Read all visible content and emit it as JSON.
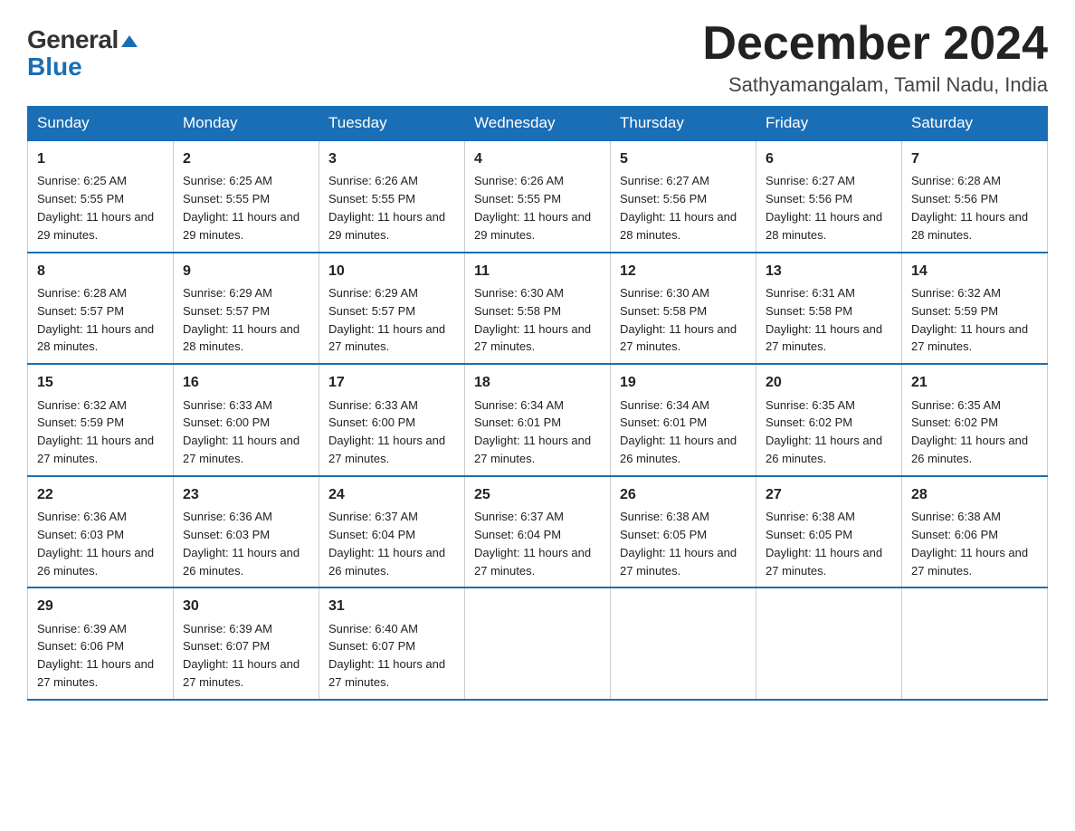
{
  "header": {
    "logo_general": "General",
    "logo_blue": "Blue",
    "month_title": "December 2024",
    "location": "Sathyamangalam, Tamil Nadu, India"
  },
  "weekdays": [
    "Sunday",
    "Monday",
    "Tuesday",
    "Wednesday",
    "Thursday",
    "Friday",
    "Saturday"
  ],
  "weeks": [
    [
      {
        "day": "1",
        "sunrise": "6:25 AM",
        "sunset": "5:55 PM",
        "daylight": "11 hours and 29 minutes."
      },
      {
        "day": "2",
        "sunrise": "6:25 AM",
        "sunset": "5:55 PM",
        "daylight": "11 hours and 29 minutes."
      },
      {
        "day": "3",
        "sunrise": "6:26 AM",
        "sunset": "5:55 PM",
        "daylight": "11 hours and 29 minutes."
      },
      {
        "day": "4",
        "sunrise": "6:26 AM",
        "sunset": "5:55 PM",
        "daylight": "11 hours and 29 minutes."
      },
      {
        "day": "5",
        "sunrise": "6:27 AM",
        "sunset": "5:56 PM",
        "daylight": "11 hours and 28 minutes."
      },
      {
        "day": "6",
        "sunrise": "6:27 AM",
        "sunset": "5:56 PM",
        "daylight": "11 hours and 28 minutes."
      },
      {
        "day": "7",
        "sunrise": "6:28 AM",
        "sunset": "5:56 PM",
        "daylight": "11 hours and 28 minutes."
      }
    ],
    [
      {
        "day": "8",
        "sunrise": "6:28 AM",
        "sunset": "5:57 PM",
        "daylight": "11 hours and 28 minutes."
      },
      {
        "day": "9",
        "sunrise": "6:29 AM",
        "sunset": "5:57 PM",
        "daylight": "11 hours and 28 minutes."
      },
      {
        "day": "10",
        "sunrise": "6:29 AM",
        "sunset": "5:57 PM",
        "daylight": "11 hours and 27 minutes."
      },
      {
        "day": "11",
        "sunrise": "6:30 AM",
        "sunset": "5:58 PM",
        "daylight": "11 hours and 27 minutes."
      },
      {
        "day": "12",
        "sunrise": "6:30 AM",
        "sunset": "5:58 PM",
        "daylight": "11 hours and 27 minutes."
      },
      {
        "day": "13",
        "sunrise": "6:31 AM",
        "sunset": "5:58 PM",
        "daylight": "11 hours and 27 minutes."
      },
      {
        "day": "14",
        "sunrise": "6:32 AM",
        "sunset": "5:59 PM",
        "daylight": "11 hours and 27 minutes."
      }
    ],
    [
      {
        "day": "15",
        "sunrise": "6:32 AM",
        "sunset": "5:59 PM",
        "daylight": "11 hours and 27 minutes."
      },
      {
        "day": "16",
        "sunrise": "6:33 AM",
        "sunset": "6:00 PM",
        "daylight": "11 hours and 27 minutes."
      },
      {
        "day": "17",
        "sunrise": "6:33 AM",
        "sunset": "6:00 PM",
        "daylight": "11 hours and 27 minutes."
      },
      {
        "day": "18",
        "sunrise": "6:34 AM",
        "sunset": "6:01 PM",
        "daylight": "11 hours and 27 minutes."
      },
      {
        "day": "19",
        "sunrise": "6:34 AM",
        "sunset": "6:01 PM",
        "daylight": "11 hours and 26 minutes."
      },
      {
        "day": "20",
        "sunrise": "6:35 AM",
        "sunset": "6:02 PM",
        "daylight": "11 hours and 26 minutes."
      },
      {
        "day": "21",
        "sunrise": "6:35 AM",
        "sunset": "6:02 PM",
        "daylight": "11 hours and 26 minutes."
      }
    ],
    [
      {
        "day": "22",
        "sunrise": "6:36 AM",
        "sunset": "6:03 PM",
        "daylight": "11 hours and 26 minutes."
      },
      {
        "day": "23",
        "sunrise": "6:36 AM",
        "sunset": "6:03 PM",
        "daylight": "11 hours and 26 minutes."
      },
      {
        "day": "24",
        "sunrise": "6:37 AM",
        "sunset": "6:04 PM",
        "daylight": "11 hours and 26 minutes."
      },
      {
        "day": "25",
        "sunrise": "6:37 AM",
        "sunset": "6:04 PM",
        "daylight": "11 hours and 27 minutes."
      },
      {
        "day": "26",
        "sunrise": "6:38 AM",
        "sunset": "6:05 PM",
        "daylight": "11 hours and 27 minutes."
      },
      {
        "day": "27",
        "sunrise": "6:38 AM",
        "sunset": "6:05 PM",
        "daylight": "11 hours and 27 minutes."
      },
      {
        "day": "28",
        "sunrise": "6:38 AM",
        "sunset": "6:06 PM",
        "daylight": "11 hours and 27 minutes."
      }
    ],
    [
      {
        "day": "29",
        "sunrise": "6:39 AM",
        "sunset": "6:06 PM",
        "daylight": "11 hours and 27 minutes."
      },
      {
        "day": "30",
        "sunrise": "6:39 AM",
        "sunset": "6:07 PM",
        "daylight": "11 hours and 27 minutes."
      },
      {
        "day": "31",
        "sunrise": "6:40 AM",
        "sunset": "6:07 PM",
        "daylight": "11 hours and 27 minutes."
      },
      null,
      null,
      null,
      null
    ]
  ]
}
